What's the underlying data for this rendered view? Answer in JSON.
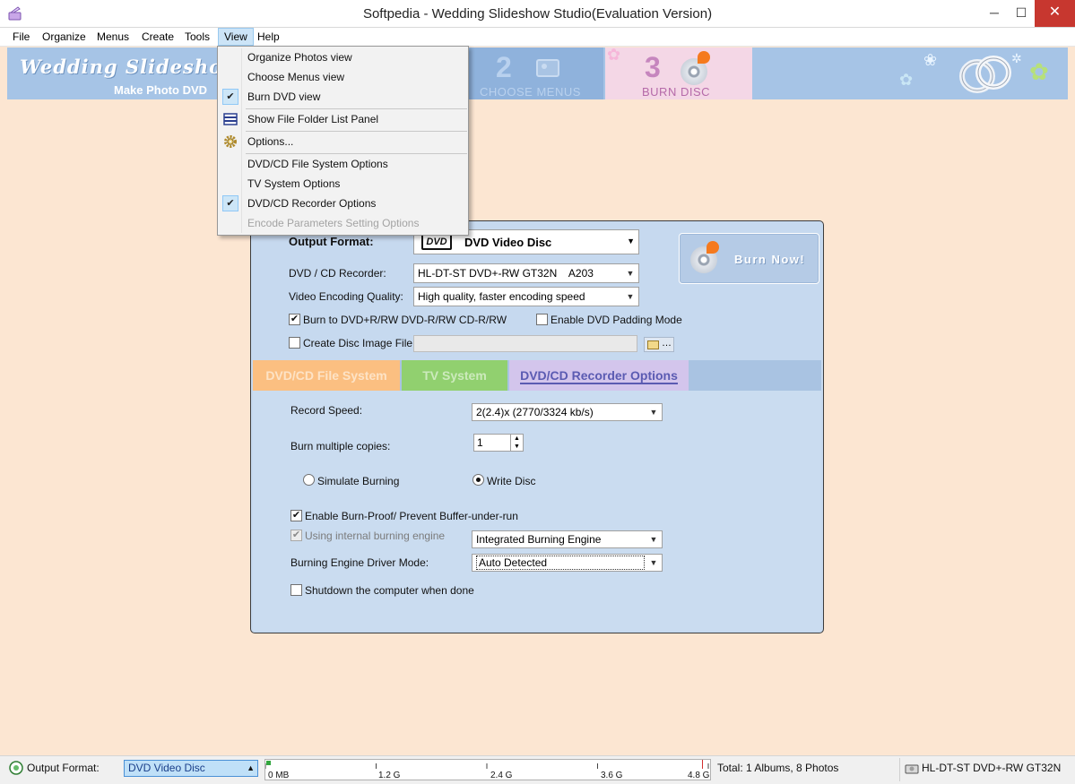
{
  "window": {
    "title": "Softpedia - Wedding Slideshow Studio(Evaluation Version)",
    "minimize_glyph": "─",
    "maximize_glyph": "☐",
    "close_glyph": "✕"
  },
  "menubar": {
    "items": [
      "File",
      "Organize",
      "Menus",
      "Create",
      "Tools",
      "View",
      "Help"
    ],
    "active": "View"
  },
  "banner": {
    "brand": "Wedding Slideshow",
    "tagline": "Make Photo DVD",
    "step2_number": "2",
    "step2_label": "CHOOSE MENUS",
    "step3_number": "3",
    "step3_label": "BURN  DISC"
  },
  "view_menu": {
    "items": [
      {
        "label": "Organize Photos view",
        "checked": false,
        "enabled": true
      },
      {
        "label": "Choose Menus view",
        "checked": false,
        "enabled": true
      },
      {
        "label": "Burn DVD view",
        "checked": true,
        "enabled": true
      },
      {
        "label": "Show File Folder List Panel",
        "checked": false,
        "enabled": true,
        "icon": "panel-icon"
      },
      {
        "label": "Options...",
        "checked": false,
        "enabled": true,
        "icon": "gear-icon"
      },
      {
        "label": "DVD/CD File System Options",
        "checked": false,
        "enabled": true
      },
      {
        "label": "TV System Options",
        "checked": false,
        "enabled": true
      },
      {
        "label": "DVD/CD Recorder Options",
        "checked": true,
        "enabled": true
      },
      {
        "label": "Encode Parameters Setting Options",
        "checked": false,
        "enabled": false
      }
    ]
  },
  "burn_panel": {
    "output_format_label": "Output Format:",
    "output_format_value": "DVD Video Disc",
    "dvd_logo_text": "DVD",
    "recorder_label": "DVD / CD Recorder:",
    "recorder_value": "HL-DT-ST DVD+-RW GT32N    A203",
    "quality_label": "Video Encoding Quality:",
    "quality_value": "High quality, faster encoding speed",
    "burn_to_label": "Burn to DVD+R/RW DVD-R/RW  CD-R/RW",
    "burn_to_checked": true,
    "padding_label": "Enable DVD Padding Mode",
    "padding_checked": false,
    "image_file_label": "Create Disc Image File:",
    "image_file_checked": false,
    "image_file_value": "",
    "browse_glyph": "…",
    "burn_now_label": "Burn Now!",
    "tabs": {
      "file_system": "DVD/CD File System",
      "tv_system": "TV System",
      "recorder_options": "DVD/CD Recorder Options"
    }
  },
  "recorder_options": {
    "record_speed_label": "Record Speed:",
    "record_speed_value": "2(2.4)x (2770/3324 kb/s)",
    "copies_label": "Burn multiple copies:",
    "copies_value": "1",
    "simulate_label": "Simulate Burning",
    "write_label": "Write Disc",
    "mode_selected": "Write Disc",
    "burnproof_label": "Enable Burn-Proof/ Prevent Buffer-under-run",
    "burnproof_checked": true,
    "internal_engine_label": "Using internal burning engine",
    "internal_engine_checked": true,
    "engine_value": "Integrated Burning Engine",
    "driver_mode_label": "Burning Engine Driver Mode:",
    "driver_mode_value": "Auto Detected",
    "shutdown_label": "Shutdown the computer when done",
    "shutdown_checked": false
  },
  "statusbar": {
    "output_format_label": "Output Format:",
    "output_format_value": "DVD Video Disc",
    "size_marks": [
      "0 MB",
      "1.2 G",
      "2.4 G",
      "3.6 G",
      "4.8 G"
    ],
    "used_fraction": 0.01,
    "totals": "Total: 1 Albums, 8 Photos",
    "drive": "HL-DT-ST DVD+-RW GT32N"
  },
  "colors": {
    "background": "#fce6d2",
    "banner": "#a6c4e6",
    "panel": "#c6d9ef",
    "tab_file_system": "#fbbf81",
    "tab_tv_system": "#91d06f",
    "tab_recorder": "#d3c5ec",
    "close_button": "#c7372f"
  }
}
